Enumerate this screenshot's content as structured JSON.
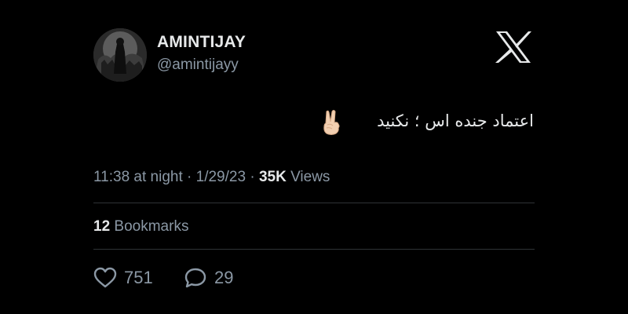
{
  "author": {
    "display_name": "AMINTIJAY",
    "handle": "@amintijayy"
  },
  "tweet": {
    "text": "اعتماد جنده اس ؛ نکنید",
    "emoji_icon": "victory-hand-icon"
  },
  "meta": {
    "time": "11:38 at night",
    "separator": "·",
    "date": "1/29/23",
    "views_count": "35K",
    "views_label": "Views"
  },
  "bookmarks": {
    "count": "12",
    "label": "Bookmarks"
  },
  "actions": {
    "likes": "751",
    "replies": "29"
  },
  "colors": {
    "background": "#000000",
    "text_primary": "#e7e9ea",
    "text_secondary": "#8b98a5",
    "divider": "#2f3336"
  }
}
